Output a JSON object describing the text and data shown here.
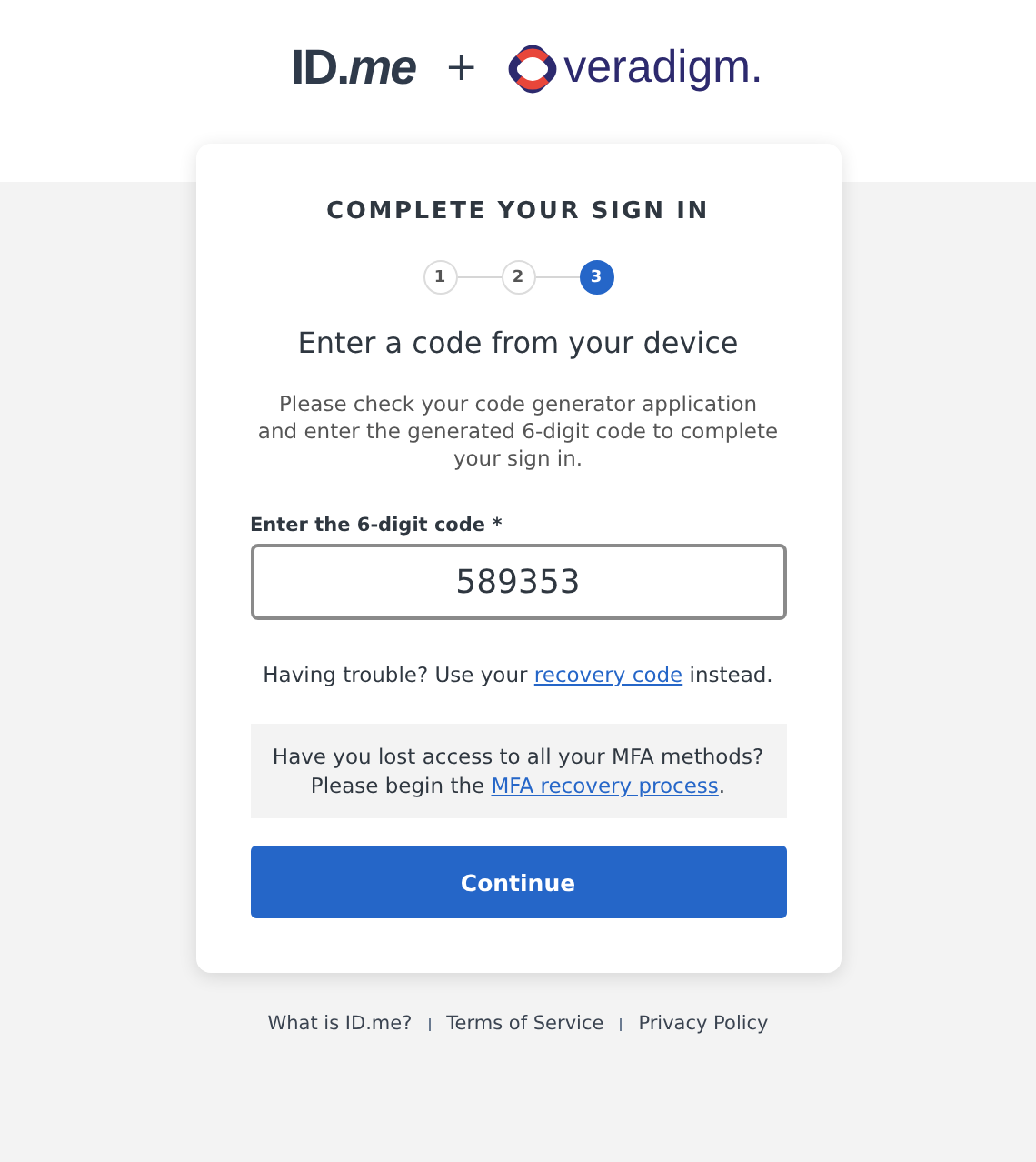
{
  "header": {
    "logo_left": "ID.*me*",
    "plus": "+",
    "logo_right": "veradigm."
  },
  "card": {
    "title": "COMPLETE YOUR SIGN IN",
    "steps": [
      {
        "label": "1",
        "selected": false
      },
      {
        "label": "2",
        "selected": false
      },
      {
        "label": "3",
        "selected": true
      }
    ],
    "heading": "Enter a code from your device",
    "instructions": "Please check your code generator application and enter the generated 6-digit code to complete your sign in.",
    "field": {
      "label": "Enter the 6-digit code *",
      "value": "589353"
    },
    "trouble": {
      "before": "Having trouble? Use your ",
      "link": "recovery code",
      "after": " instead."
    },
    "recovery_box": {
      "line": "Have you lost access to all your MFA methods?",
      "before": "Please begin the ",
      "link": "MFA recovery process",
      "after": "."
    },
    "button": "Continue"
  },
  "footer_links": [
    "What is ID.me?",
    "Terms of Service",
    "Privacy Policy"
  ]
}
